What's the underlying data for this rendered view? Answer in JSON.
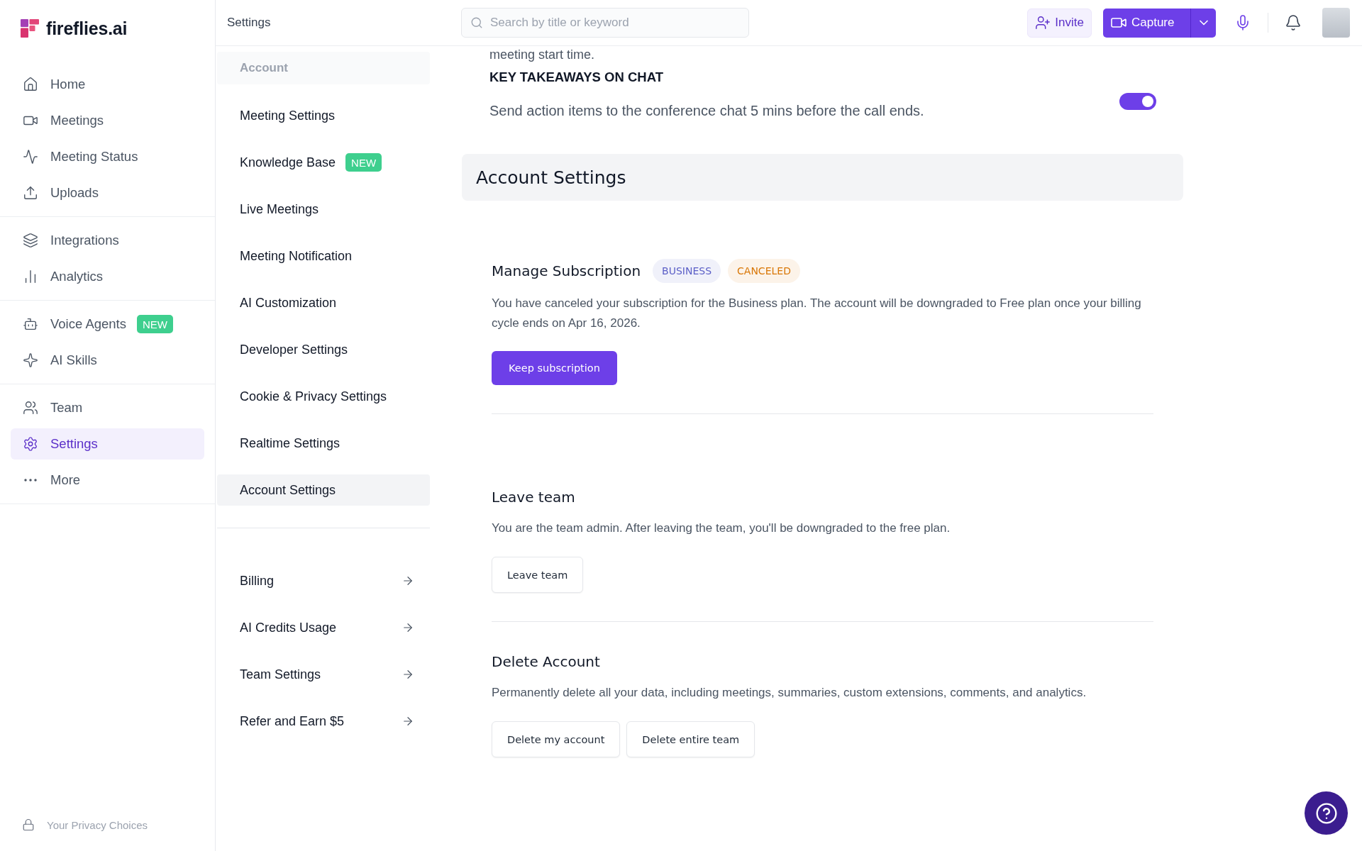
{
  "sidebar": {
    "logo": "fireflies.ai",
    "sections": [
      {
        "items": [
          {
            "label": "Home",
            "selected": false
          },
          {
            "label": "Meetings",
            "selected": false
          },
          {
            "label": "Meeting Status",
            "selected": false
          },
          {
            "label": "Uploads",
            "selected": false
          }
        ]
      },
      {
        "items": [
          {
            "label": "Integrations",
            "selected": false
          },
          {
            "label": "Analytics",
            "selected": false
          }
        ]
      },
      {
        "items": [
          {
            "label": "Voice Agents",
            "selected": false,
            "badge": "NEW"
          },
          {
            "label": "AI Skills",
            "selected": false
          }
        ]
      },
      {
        "items": [
          {
            "label": "Team",
            "selected": false
          },
          {
            "label": "Settings",
            "selected": true
          },
          {
            "label": "More",
            "selected": false
          }
        ]
      }
    ],
    "footer": "Your Privacy Choices"
  },
  "header": {
    "title": "Settings",
    "search": {
      "placeholder": "Search by title or keyword"
    },
    "invite": "Invite",
    "capture": "Capture"
  },
  "settings_nav": {
    "heading": "Account",
    "items": [
      {
        "label": "Meeting Settings",
        "selected": false
      },
      {
        "label": "Knowledge Base",
        "selected": false,
        "badge": "NEW"
      },
      {
        "label": "Live Meetings",
        "selected": false
      },
      {
        "label": "Meeting Notification",
        "selected": false
      },
      {
        "label": "AI Customization",
        "selected": false
      },
      {
        "label": "Developer Settings",
        "selected": false
      },
      {
        "label": "Cookie & Privacy Settings",
        "selected": false
      },
      {
        "label": "Realtime Settings",
        "selected": false
      },
      {
        "label": "Account Settings",
        "selected": true
      }
    ],
    "links": [
      {
        "label": "Billing"
      },
      {
        "label": "AI Credits Usage"
      },
      {
        "label": "Team Settings"
      },
      {
        "label": "Refer and Earn $5"
      }
    ]
  },
  "content": {
    "partial_text": "meeting start time.",
    "key_takeaways": {
      "title": "KEY TAKEAWAYS ON CHAT",
      "description": "Send action items to the conference chat 5 mins before the call ends.",
      "on": true
    },
    "section_title": "Account Settings",
    "subscription": {
      "title": "Manage Subscription",
      "badges": [
        {
          "label": "BUSINESS",
          "color": "#5b5fc7"
        },
        {
          "label": "CANCELED",
          "color": "#d97706"
        }
      ],
      "text": "You have canceled your subscription for the Business plan. The account will be downgraded to Free plan once your billing cycle ends on Apr 16, 2026.",
      "button": "Keep subscription"
    },
    "leave_team": {
      "title": "Leave team",
      "text": "You are the team admin. After leaving the team, you'll be downgraded to the free plan.",
      "button": "Leave team"
    },
    "delete_account": {
      "title": "Delete Account",
      "text": "Permanently delete all your data, including meetings, summaries, custom extensions, comments, and analytics.",
      "buttons": [
        "Delete my account",
        "Delete entire team"
      ]
    }
  }
}
